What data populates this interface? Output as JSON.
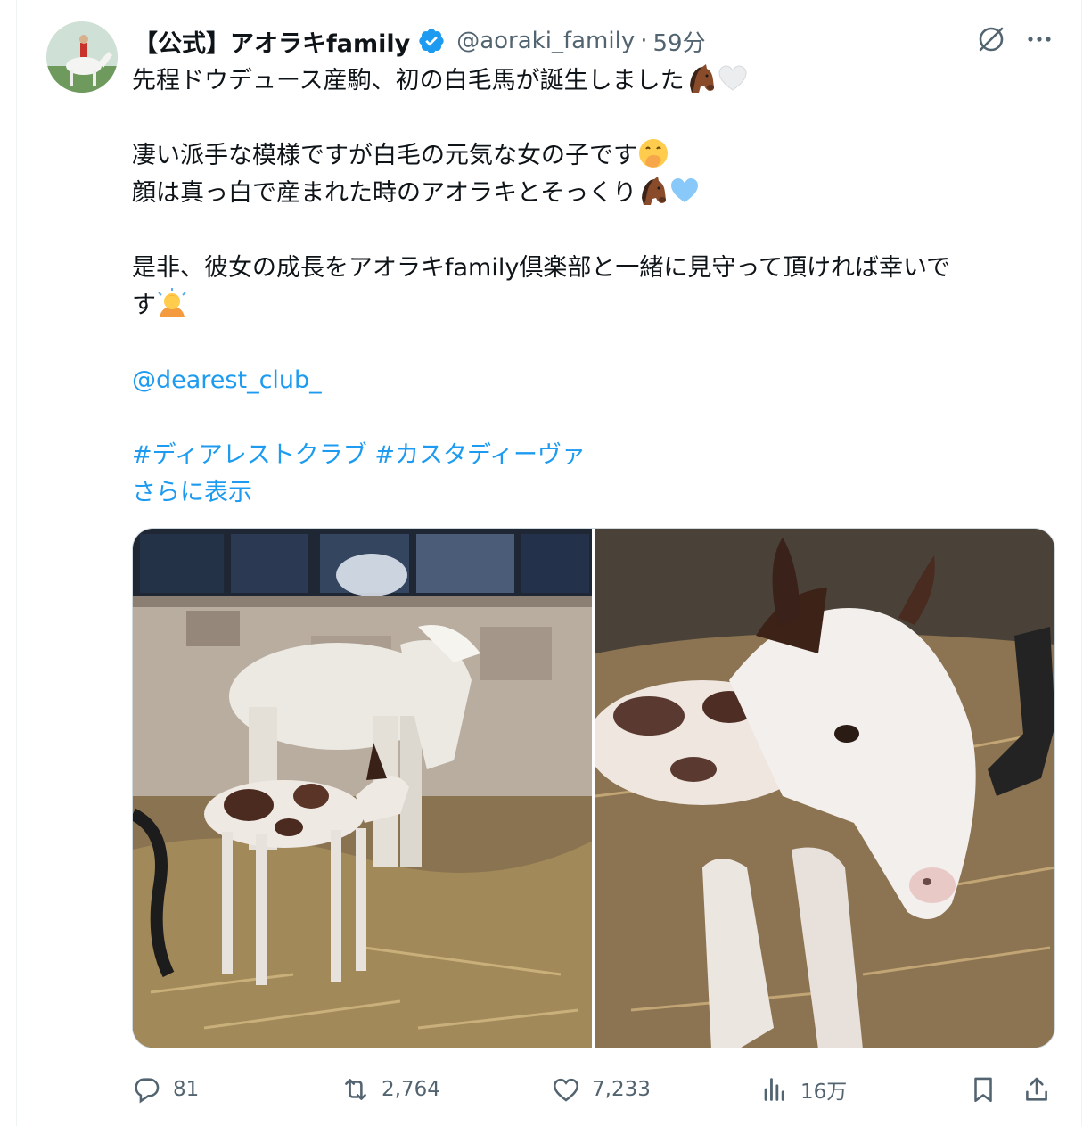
{
  "tweet": {
    "author": {
      "display_name": "【公式】アオラキfamily",
      "handle": "@aoraki_family",
      "separator": "·",
      "time": "59分",
      "verified": true
    },
    "text": {
      "line1": "先程ドウデュース産駒、初の白毛馬が誕生しました",
      "line2": "凄い派手な模様ですが白毛の元気な女の子です",
      "line3": "顔は真っ白で産まれた時のアオラキとそっくり",
      "line4": "是非、彼女の成長をアオラキfamily倶楽部と一緒に見守って頂ければ幸いで",
      "line5": "す",
      "mention": "@dearest_club_",
      "hashtag1": "#ディアレストクラブ",
      "hashtag2": "#カスタディーヴァ",
      "show_more": "さらに表示"
    },
    "emojis": {
      "line1": [
        "horse-face",
        "white-heart"
      ],
      "line2": [
        "face-with-hand-over-mouth"
      ],
      "line3": [
        "horse-face",
        "light-blue-heart"
      ],
      "line5": [
        "person-bowing"
      ]
    },
    "media": [
      "mare-and-piebald-foal-photo",
      "piebald-foal-lying-in-straw-photo"
    ],
    "metrics": {
      "replies": "81",
      "reposts": "2,764",
      "likes": "7,233",
      "views": "16万"
    }
  },
  "colors": {
    "text": "#0f1419",
    "secondary": "#536471",
    "link": "#1d9bf0",
    "verified": "#1d9bf0",
    "border": "#cfd9de"
  }
}
